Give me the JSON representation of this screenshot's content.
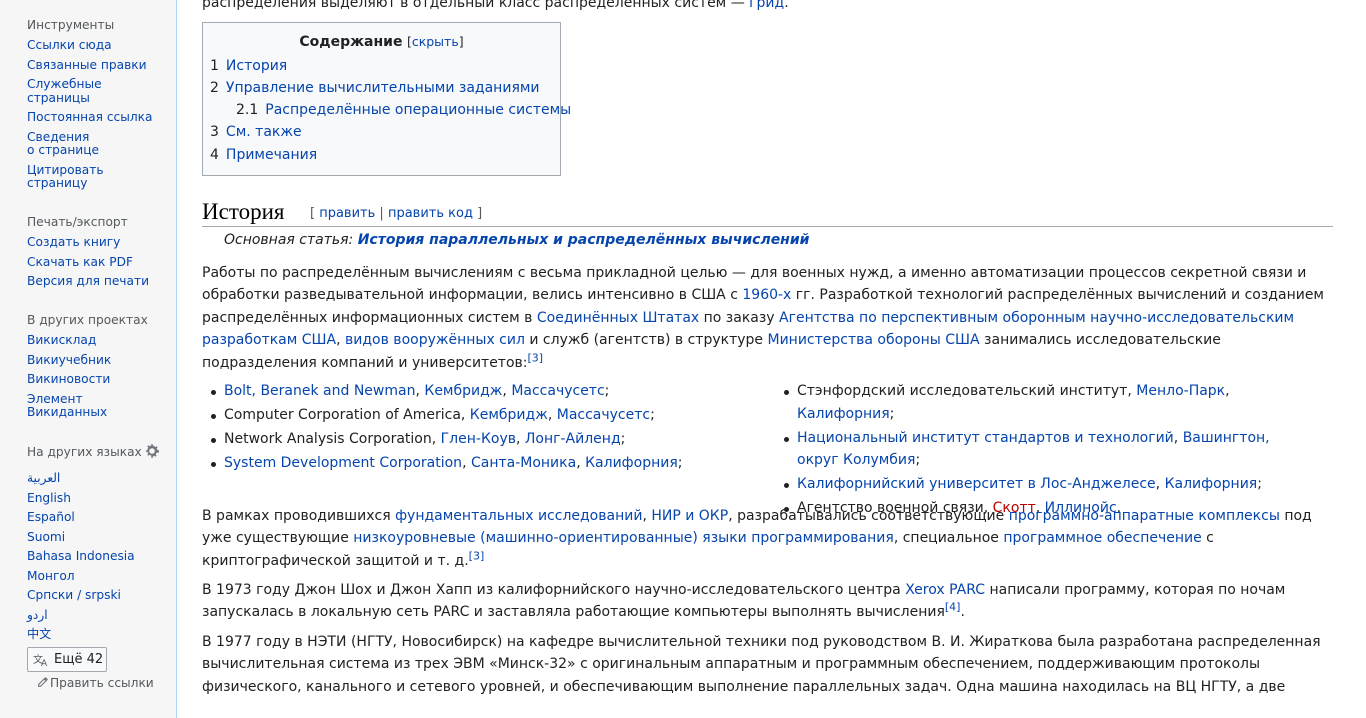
{
  "sidebar": {
    "tools": {
      "title": "Инструменты",
      "items": [
        "Ссылки сюда",
        "Связанные правки",
        "Служебные\nстраницы",
        "Постоянная ссылка",
        "Сведения\nо странице",
        "Цитировать\nстраницу"
      ]
    },
    "print": {
      "title": "Печать/экспорт",
      "items": [
        "Создать книгу",
        "Скачать как PDF",
        "Версия для печати"
      ]
    },
    "projects": {
      "title": "В других проектах",
      "items": [
        "Викисклад",
        "Викиучебник",
        "Викиновости",
        "Элемент\nВикиданных"
      ]
    },
    "languages": {
      "title": "На других языках",
      "items": [
        "العربية",
        "English",
        "Español",
        "Suomi",
        "Bahasa Indonesia",
        "Монгол",
        "Српски / srpski",
        "اردو",
        "中文"
      ],
      "more_label": "Ещё 42",
      "edit_links": "Править ссылки"
    }
  },
  "top_text": {
    "before": "распределения выделяют в отдельный класс распределенных систем — ",
    "link": "грид",
    "after": "."
  },
  "toc": {
    "title": "Содержание",
    "toggle_open": "[",
    "toggle_label": "скрыть",
    "toggle_close": "]",
    "items": [
      {
        "num": "1",
        "label": "История"
      },
      {
        "num": "2",
        "label": "Управление вычислительными заданиями"
      },
      {
        "num": "2.1",
        "label": "Распределённые операционные системы"
      },
      {
        "num": "3",
        "label": "См. также"
      },
      {
        "num": "4",
        "label": "Примечания"
      }
    ]
  },
  "section": {
    "title": "История",
    "edit_open": "[",
    "edit_label": "править",
    "edit_sep": "|",
    "edit_code_label": "править код",
    "edit_close": "]"
  },
  "hatnote": {
    "prefix": "Основная статья: ",
    "link": "История параллельных и распределённых вычислений"
  },
  "para1": {
    "t1": "Работы по распределённым вычислениям с весьма прикладной целью — для военных нужд, а именно автоматизации процессов секретной связи и обработки разведывательной информации, велись интенсивно в США с ",
    "l1": "1960-х",
    "t2": " гг. Разработкой технологий распределённых вычислений и созданием распределённых информационных систем в ",
    "l2": "Соединённых Штатах",
    "t3": " по заказу ",
    "l3": "Агентства по перспективным оборонным научно-исследовательским разработкам США",
    "t4": ", ",
    "l4": "видов вооружённых сил",
    "t5": " и служб (агентств) в структуре ",
    "l5": "Министерства обороны США",
    "t6": " занимались исследовательские подразделения компаний и университетов:",
    "ref": "[3]"
  },
  "list_left": {
    "i1": {
      "l1": "Bolt, Beranek and Newman",
      "s1": ", ",
      "l2": "Кембридж",
      "s2": ", ",
      "l3": "Массачусетс",
      "end": ";"
    },
    "i2": {
      "t": "Computer Corporation of America, ",
      "l1": "Кембридж",
      "s1": ", ",
      "l2": "Массачусетс",
      "end": ";"
    },
    "i3": {
      "t": "Network Analysis Corporation, ",
      "l1": "Глен-Коув",
      "s1": ", ",
      "l2": "Лонг-Айленд",
      "end": ";"
    },
    "i4": {
      "l1": "System Development Corporation",
      "s1": ", ",
      "l2": "Санта-Моника",
      "s2": ", ",
      "l3": "Калифорния",
      "end": ";"
    }
  },
  "list_right": {
    "i1": {
      "t": "Стэнфордский исследовательский институт, ",
      "l1": "Менло-Парк",
      "s1": ", ",
      "l2": "Калифорния",
      "end": ";"
    },
    "i2": {
      "l1": "Национальный институт стандартов и технологий",
      "s1": ", ",
      "l2": "Вашингтон, округ Колумбия",
      "end": ";"
    },
    "i3": {
      "l1": "Калифорнийский университет в Лос-Анджелесе",
      "s1": ", ",
      "l2": "Калифорния",
      "end": ";"
    },
    "i4": {
      "t": "Агентство военной связи, ",
      "l1": "Скотт",
      "s1": ", ",
      "l2": "Иллинойс",
      "end": "."
    }
  },
  "para2": {
    "t1": "В рамках проводившихся ",
    "l1": "фундаментальных исследований",
    "t2": ", ",
    "l2": "НИР и ОКР",
    "t3": ", разрабатывались соответствующие ",
    "l3": "программно-аппаратные комплексы",
    "t4": " под уже существующие ",
    "l4": "низкоуровневые (машинно-ориентированные) языки программирования",
    "t5": ", специальное ",
    "l5": "программное обеспечение",
    "t6": " с криптографической защитой и т. д.",
    "ref": "[3]"
  },
  "para3": {
    "t1": "В 1973 году Джон Шох и Джон Хапп из калифорнийского научно-исследовательского центра ",
    "l1": "Xerox PARC",
    "t2": " написали программу, которая по ночам запускалась в локальную сеть PARC и заставляла работающие компьютеры выполнять вычисления",
    "ref": "[4]",
    "t3": "."
  },
  "para4": {
    "t1": "В 1977 году в НЭТИ (НГТУ, Новосибирск) на кафедре вычислительной техники под руководством В. И. Жираткова была разработана распределенная вычислительная система из трех ЭВМ «Минск-32» с оригинальным аппаратным и программным обеспечением, поддерживающим протоколы физического, канального и сетевого уровней, и обеспечивающим выполнение параллельных задач. Одна машина находилась на ВЦ НГТУ, а две"
  }
}
